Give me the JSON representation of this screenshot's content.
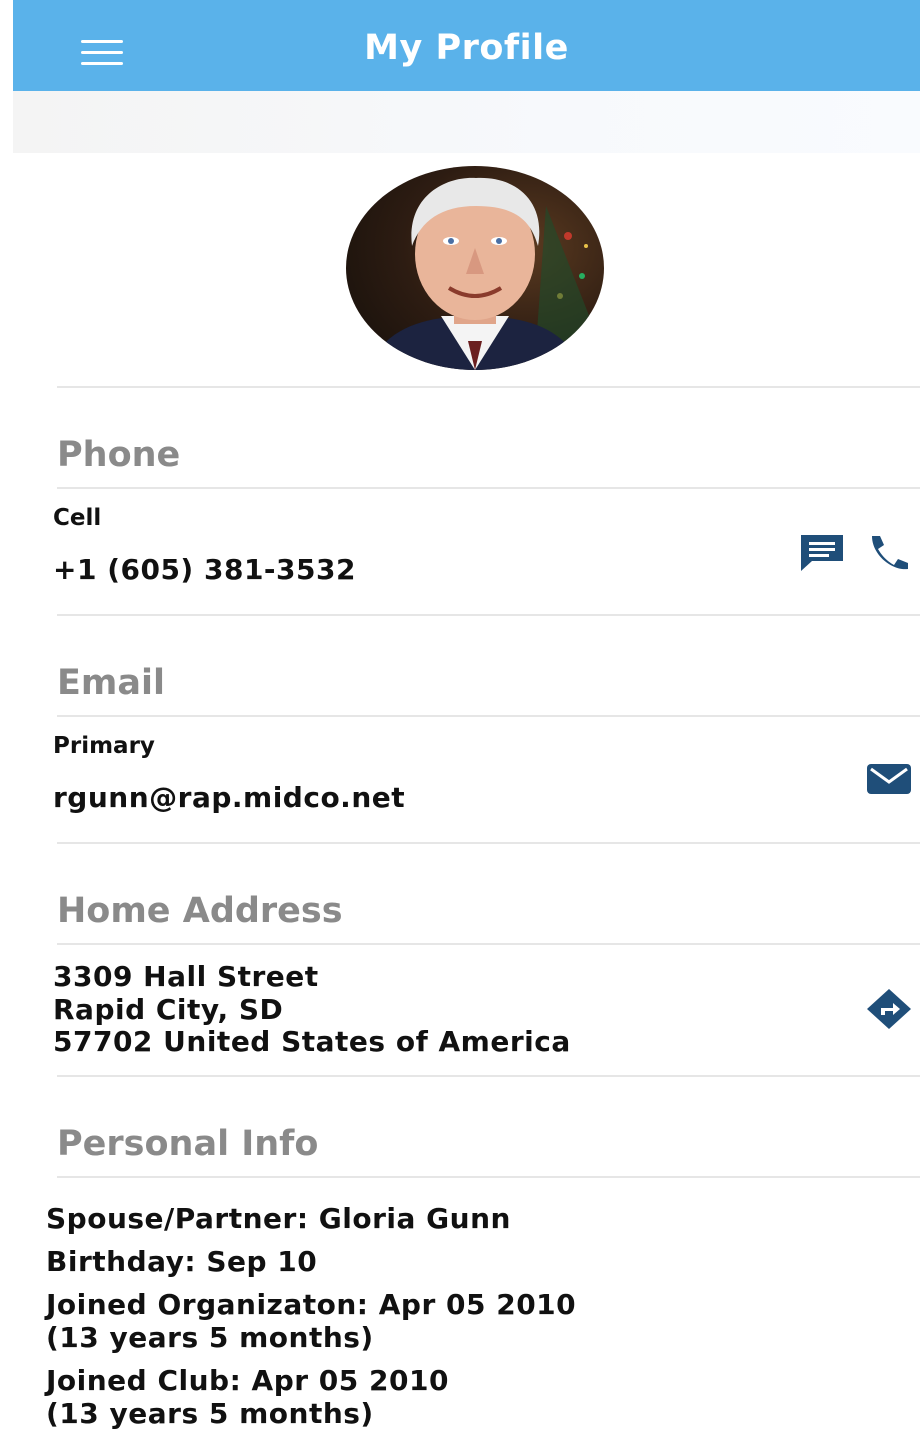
{
  "header": {
    "title": "My Profile",
    "menu_icon": "hamburger-menu-icon",
    "background_color": "#5ab2ea"
  },
  "profile": {
    "avatar": "profile-photo"
  },
  "phone": {
    "section_title": "Phone",
    "label": "Cell",
    "number": "+1 (605) 381-3532",
    "actions": [
      "message-icon",
      "call-icon"
    ]
  },
  "email": {
    "section_title": "Email",
    "label": "Primary",
    "address": "rgunn@rap.midco.net",
    "action": "mail-icon"
  },
  "home_address": {
    "section_title": "Home Address",
    "lines": [
      "3309 Hall Street",
      "Rapid City, SD",
      "57702 United States of America"
    ],
    "action": "directions-icon"
  },
  "personal_info": {
    "section_title": "Personal Info",
    "spouse": "Spouse/Partner: Gloria Gunn",
    "birthday": "Birthday: Sep 10",
    "joined_org": "Joined Organizaton: Apr 05 2010",
    "joined_org_duration": "(13 years 5 months)",
    "joined_club": "Joined Club: Apr 05 2010",
    "joined_club_duration": "(13 years 5 months)"
  },
  "colors": {
    "icon": "#1f4e79",
    "section_title": "#8a8a8a",
    "divider": "#e6e6e6"
  }
}
